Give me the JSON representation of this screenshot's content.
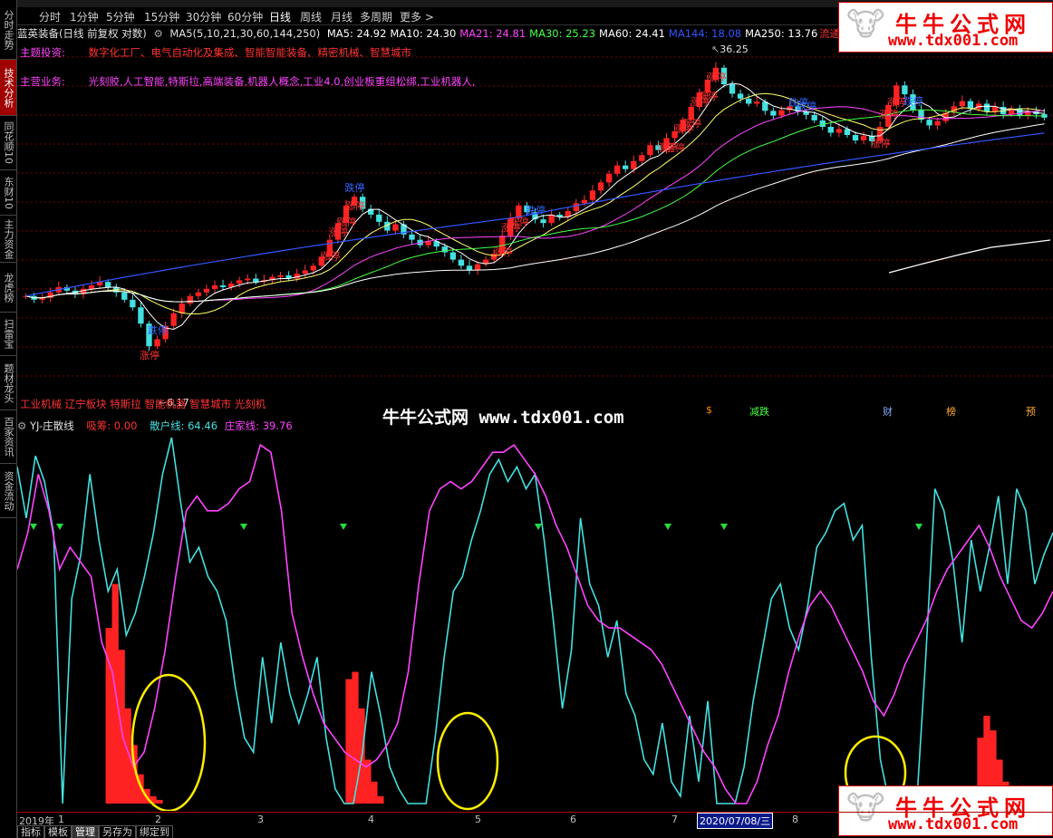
{
  "nav": [
    {
      "label": "分时走势",
      "active": false
    },
    {
      "label": "技术分析",
      "active": true
    },
    {
      "label": "同花顺10",
      "active": false
    },
    {
      "label": "东财10",
      "active": false
    },
    {
      "label": "主力资金",
      "active": false
    },
    {
      "label": "龙虎榜",
      "active": false
    },
    {
      "label": "扫雷宝",
      "active": false
    },
    {
      "label": "题材龙头",
      "active": false
    },
    {
      "label": "百家资讯",
      "active": false
    },
    {
      "label": "资金流动",
      "active": false
    }
  ],
  "periods": [
    "分时",
    "1分钟",
    "5分钟",
    "15分钟",
    "30分钟",
    "60分钟",
    "日线",
    "周线",
    "月线",
    "多周期",
    "更多 >"
  ],
  "active_period": "日线",
  "stock": {
    "title": "蓝英装备(日线 前复权 对数)",
    "ma_params": "MA5(5,10,21,30,60,144,250)",
    "mas": [
      {
        "label": "MA5: 24.92",
        "color": "#ffffff"
      },
      {
        "label": "MA10: 24.30",
        "color": "#ffffff"
      },
      {
        "label": "MA21: 24.81",
        "color": "#ff44ff"
      },
      {
        "label": "MA30: 25.23",
        "color": "#44ff44"
      },
      {
        "label": "MA60: 24.41",
        "color": "#ffffff"
      },
      {
        "label": "MA144: 18.08",
        "color": "#3355ff"
      },
      {
        "label": "MA250: 13.76",
        "color": "#ffffff"
      }
    ],
    "float_label": "流通"
  },
  "theme": {
    "label": "主题投资:",
    "text": "数字化工厂、电气自动化及集成、智能智能装备、精密机械、智慧城市"
  },
  "business": {
    "label": "主营业务:",
    "text": "光刻胶,人工智能,特斯拉,高端装备,机器人概念,工业4.0,创业板重组松绑,工业机器人,"
  },
  "price_high": "36.25",
  "price_low": "6.17",
  "bottom_concepts": "工业机械 辽宁板块 特斯拉 智能机器 智慧城市 光刻机",
  "event_markers": [
    {
      "label": "$",
      "color": "#ff8800"
    },
    {
      "label": "减跌",
      "color": "#44ff44"
    },
    {
      "label": "财",
      "color": "#88aaff"
    },
    {
      "label": "榜",
      "color": "#ffaa33"
    },
    {
      "label": "预",
      "color": "#ffaa33"
    }
  ],
  "watermark": {
    "text": "牛牛公式网 www.tdx001.com",
    "logo_cn": "牛牛公式网",
    "logo_url": "www.tdx001.com"
  },
  "indicator": {
    "name": "YJ-庄散线",
    "chip": {
      "label": "吸筹: 0.00",
      "color": "#ff3333"
    },
    "retail": {
      "label": "散户线: 64.46",
      "color": "#44e0e0"
    },
    "dealer": {
      "label": "庄家线: 39.76",
      "color": "#ff44ff"
    }
  },
  "time_axis": {
    "ticks": [
      "2019年",
      "1",
      "2",
      "3",
      "4",
      "5",
      "6",
      "7",
      "8"
    ],
    "current_date": "2020/07/08/三"
  },
  "bottom_tabs": [
    "指标",
    "模板",
    "管理",
    "另存为",
    "绑定到"
  ],
  "limit_up_label": "涨停",
  "limit_down_label": "跌停",
  "chart_data": {
    "type": "line",
    "title": "",
    "series": [
      {
        "name": "散户线",
        "color": "#44e0e0",
        "values": [
          92,
          78,
          95,
          88,
          74,
          0,
          56,
          68,
          90,
          72,
          58,
          64,
          46,
          52,
          62,
          74,
          90,
          100,
          82,
          66,
          70,
          62,
          58,
          50,
          32,
          18,
          14,
          40,
          22,
          44,
          30,
          22,
          30,
          40,
          18,
          4,
          0,
          0,
          14,
          36,
          24,
          10,
          4,
          0,
          0,
          0,
          18,
          40,
          58,
          62,
          72,
          80,
          90,
          94,
          88,
          92,
          86,
          90,
          72,
          50,
          26,
          42,
          78,
          60,
          54,
          40,
          50,
          30,
          24,
          12,
          8,
          22,
          6,
          2,
          24,
          6,
          28,
          0,
          0,
          0,
          10,
          28,
          42,
          56,
          60,
          48,
          42,
          54,
          70,
          74,
          80,
          82,
          72,
          76,
          40,
          12,
          0,
          0,
          0,
          0,
          40,
          86,
          80,
          66,
          44,
          72,
          58,
          70,
          84,
          60,
          86,
          80,
          60,
          68,
          74
        ]
      },
      {
        "name": "庄家线",
        "color": "#ff44ff",
        "values": [
          64,
          74,
          90,
          80,
          64,
          70,
          66,
          62,
          44,
          36,
          18,
          10,
          14,
          26,
          42,
          62,
          80,
          84,
          80,
          80,
          82,
          86,
          88,
          98,
          96,
          80,
          52,
          40,
          30,
          22,
          18,
          14,
          12,
          10,
          12,
          16,
          22,
          36,
          60,
          80,
          86,
          88,
          86,
          88,
          92,
          96,
          96,
          98,
          94,
          90,
          84,
          76,
          70,
          62,
          54,
          50,
          48,
          48,
          46,
          44,
          42,
          38,
          32,
          26,
          20,
          14,
          10,
          4,
          0,
          0,
          6,
          16,
          24,
          36,
          46,
          54,
          58,
          54,
          48,
          42,
          36,
          28,
          24,
          30,
          38,
          44,
          50,
          58,
          64,
          68,
          72,
          76,
          70,
          62,
          56,
          50,
          48,
          52,
          58
        ]
      },
      {
        "name": "吸筹",
        "color": "#ff2222",
        "values": [
          0,
          0,
          0,
          0,
          0,
          0,
          0,
          0,
          0,
          0,
          0,
          0,
          0,
          0,
          48,
          60,
          42,
          26,
          16,
          8,
          4,
          2,
          1,
          0,
          0,
          0,
          0,
          0,
          0,
          0,
          0,
          0,
          0,
          0,
          0,
          0,
          0,
          0,
          0,
          0,
          0,
          0,
          0,
          0,
          0,
          0,
          0,
          0,
          0,
          0,
          0,
          0,
          34,
          36,
          26,
          12,
          6,
          2,
          0,
          0,
          0,
          0,
          0,
          0,
          0,
          0,
          0,
          0,
          0,
          0,
          0,
          0,
          0,
          0,
          0,
          0,
          0,
          0,
          0,
          0,
          0,
          0,
          0,
          0,
          0,
          0,
          0,
          0,
          0,
          0,
          0,
          0,
          0,
          0,
          0,
          0,
          0,
          0,
          0,
          0,
          0,
          0,
          0,
          0,
          0,
          0,
          0,
          0,
          0,
          0,
          0,
          0,
          0,
          0,
          0,
          0,
          0,
          0,
          0,
          0,
          0,
          0,
          0,
          0,
          0,
          0,
          0,
          0,
          0,
          0,
          0,
          0,
          0,
          0,
          0,
          0,
          0,
          0,
          0,
          0,
          0,
          0,
          0,
          0,
          0,
          0,
          0,
          0,
          0,
          0,
          0,
          0,
          18,
          24,
          20,
          12,
          6,
          3,
          0,
          0,
          0,
          0,
          0,
          0
        ]
      }
    ],
    "ylim": [
      0,
      100
    ]
  },
  "price_series": {
    "close": [
      10.0,
      9.8,
      9.9,
      10.2,
      10.5,
      10.3,
      10.1,
      10.4,
      10.6,
      10.8,
      10.5,
      10.2,
      9.8,
      9.4,
      8.6,
      7.6,
      7.9,
      8.5,
      9.1,
      9.6,
      10.0,
      10.2,
      10.4,
      10.6,
      10.5,
      10.7,
      10.9,
      11.0,
      10.8,
      10.9,
      11.1,
      11.2,
      11.0,
      11.3,
      11.5,
      11.8,
      12.4,
      13.6,
      14.9,
      16.4,
      17.2,
      16.1,
      15.6,
      15.0,
      14.3,
      14.8,
      14.0,
      13.6,
      13.2,
      13.5,
      13.1,
      12.7,
      12.2,
      11.8,
      11.5,
      11.9,
      12.2,
      12.6,
      13.9,
      15.3,
      16.4,
      15.8,
      15.2,
      14.9,
      15.6,
      15.4,
      15.9,
      16.6,
      16.9,
      17.8,
      18.6,
      19.5,
      20.4,
      20.0,
      20.9,
      21.6,
      22.8,
      22.2,
      23.7,
      24.6,
      26.2,
      28.1,
      30.4,
      32.6,
      34.8,
      31.8,
      30.2,
      29.4,
      28.6,
      28.9,
      27.5,
      26.8,
      27.6,
      28.2,
      27.4,
      26.9,
      26.1,
      25.2,
      24.4,
      24.9,
      24.1,
      23.4,
      24.0,
      23.3,
      25.2,
      28.4,
      31.6,
      30.1,
      27.6,
      26.2,
      25.4,
      26.0,
      27.2,
      28.2,
      29.0,
      27.8,
      28.6,
      27.4,
      28.1,
      27.0,
      27.9,
      26.8,
      27.4,
      27.0,
      26.5
    ]
  }
}
